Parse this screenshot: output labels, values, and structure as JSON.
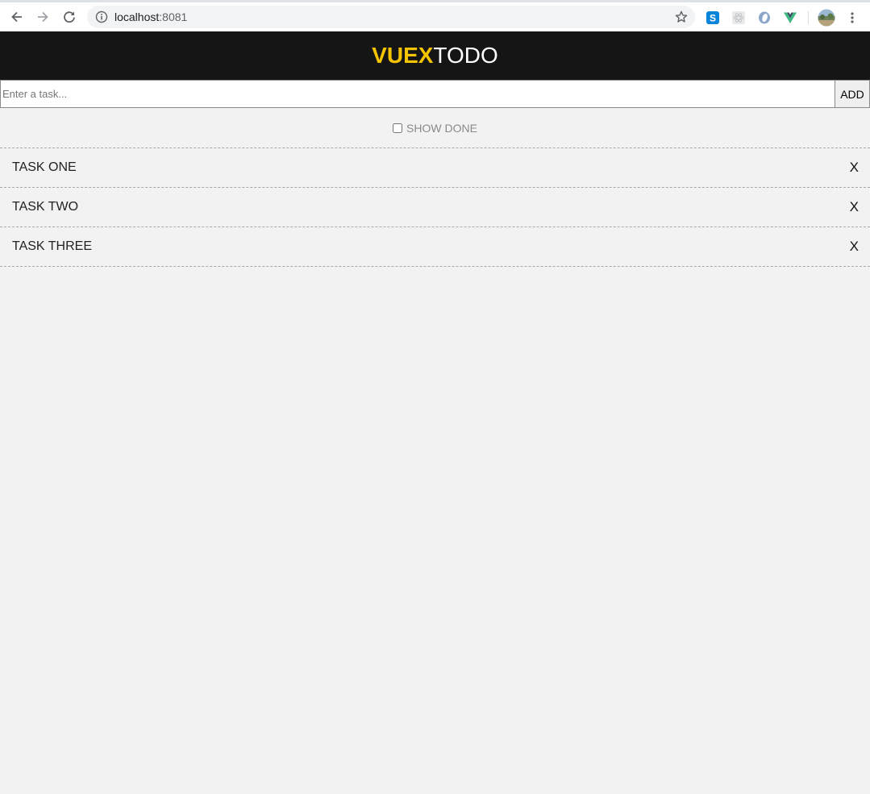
{
  "browser": {
    "url_host": "localhost",
    "url_port": ":8081"
  },
  "app": {
    "brand_part1": "VUEX",
    "brand_part2": "TODO"
  },
  "form": {
    "placeholder": "Enter a task...",
    "value": "",
    "add_label": "ADD"
  },
  "filter": {
    "label": "SHOW DONE",
    "checked": false
  },
  "tasks": [
    {
      "name": "TASK ONE",
      "remove_label": "X"
    },
    {
      "name": "TASK TWO",
      "remove_label": "X"
    },
    {
      "name": "TASK THREE",
      "remove_label": "X"
    }
  ],
  "colors": {
    "header_bg": "#151515",
    "brand_accent": "#f5c400",
    "page_bg": "#f2f2f2"
  },
  "icons": {
    "back": "arrow-left-icon",
    "forward": "arrow-right-icon",
    "reload": "reload-icon",
    "site_info": "info-icon",
    "bookmark": "star-icon",
    "extensions": [
      "skype-icon",
      "react-devtools-icon",
      "opera-icon",
      "vue-devtools-icon"
    ],
    "profile": "avatar",
    "menu": "kebab-menu-icon"
  }
}
